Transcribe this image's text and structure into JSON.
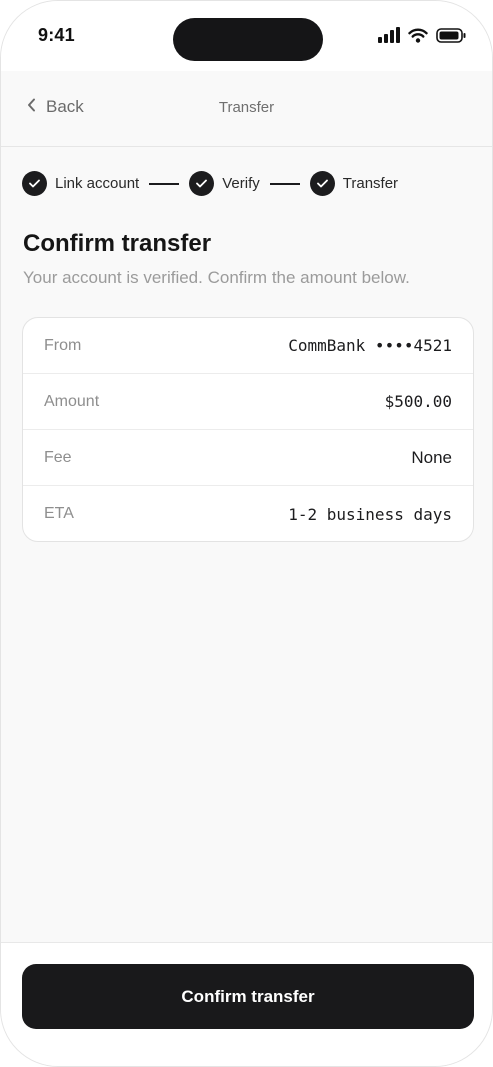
{
  "status_bar": {
    "time": "9:41"
  },
  "nav": {
    "back_label": "Back",
    "title": "Transfer"
  },
  "stepper": {
    "steps": [
      {
        "label": "Link account",
        "state": "complete"
      },
      {
        "label": "Verify",
        "state": "complete"
      },
      {
        "label": "Transfer",
        "state": "complete"
      }
    ]
  },
  "content": {
    "heading": "Confirm transfer",
    "subtitle": "Your account is verified. Confirm the amount below."
  },
  "details": {
    "rows": [
      {
        "label": "From",
        "value": "CommBank ••••4521"
      },
      {
        "label": "Amount",
        "value": "$500.00"
      },
      {
        "label": "Fee",
        "value": "None"
      },
      {
        "label": "ETA",
        "value": "1-2 business days"
      }
    ]
  },
  "footer": {
    "confirm_label": "Confirm transfer"
  },
  "colors": {
    "accent": "#1c1c1e",
    "muted_text": "#9b9b9b",
    "background": "#f9f9f9"
  },
  "icons": [
    "signal-icon",
    "wifi-icon",
    "battery-icon",
    "chevron-left-icon",
    "check-icon"
  ]
}
